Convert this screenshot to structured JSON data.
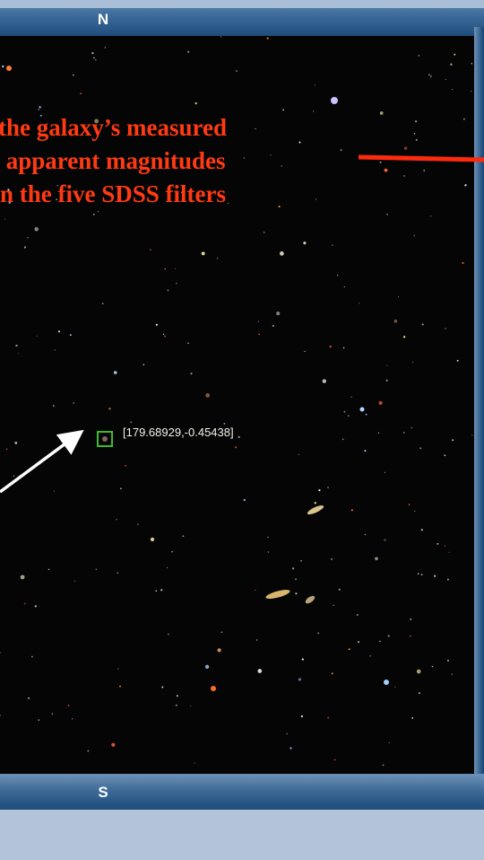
{
  "map_frame": {
    "north_label": "N",
    "south_label": "S"
  },
  "annotation": {
    "text": "the galaxy’s measured\n apparent magnitudes\nn the five SDSS filters"
  },
  "target": {
    "coordinates_label": "[179.68929,-0.45438]"
  },
  "colors": {
    "annotation_text": "#ff3a12",
    "red_arrow": "#ff2a0e",
    "white_arrow": "#ffffff",
    "target_box": "#3dbb2a",
    "frame_blue": "#2b5a88",
    "sky": "#050506"
  }
}
